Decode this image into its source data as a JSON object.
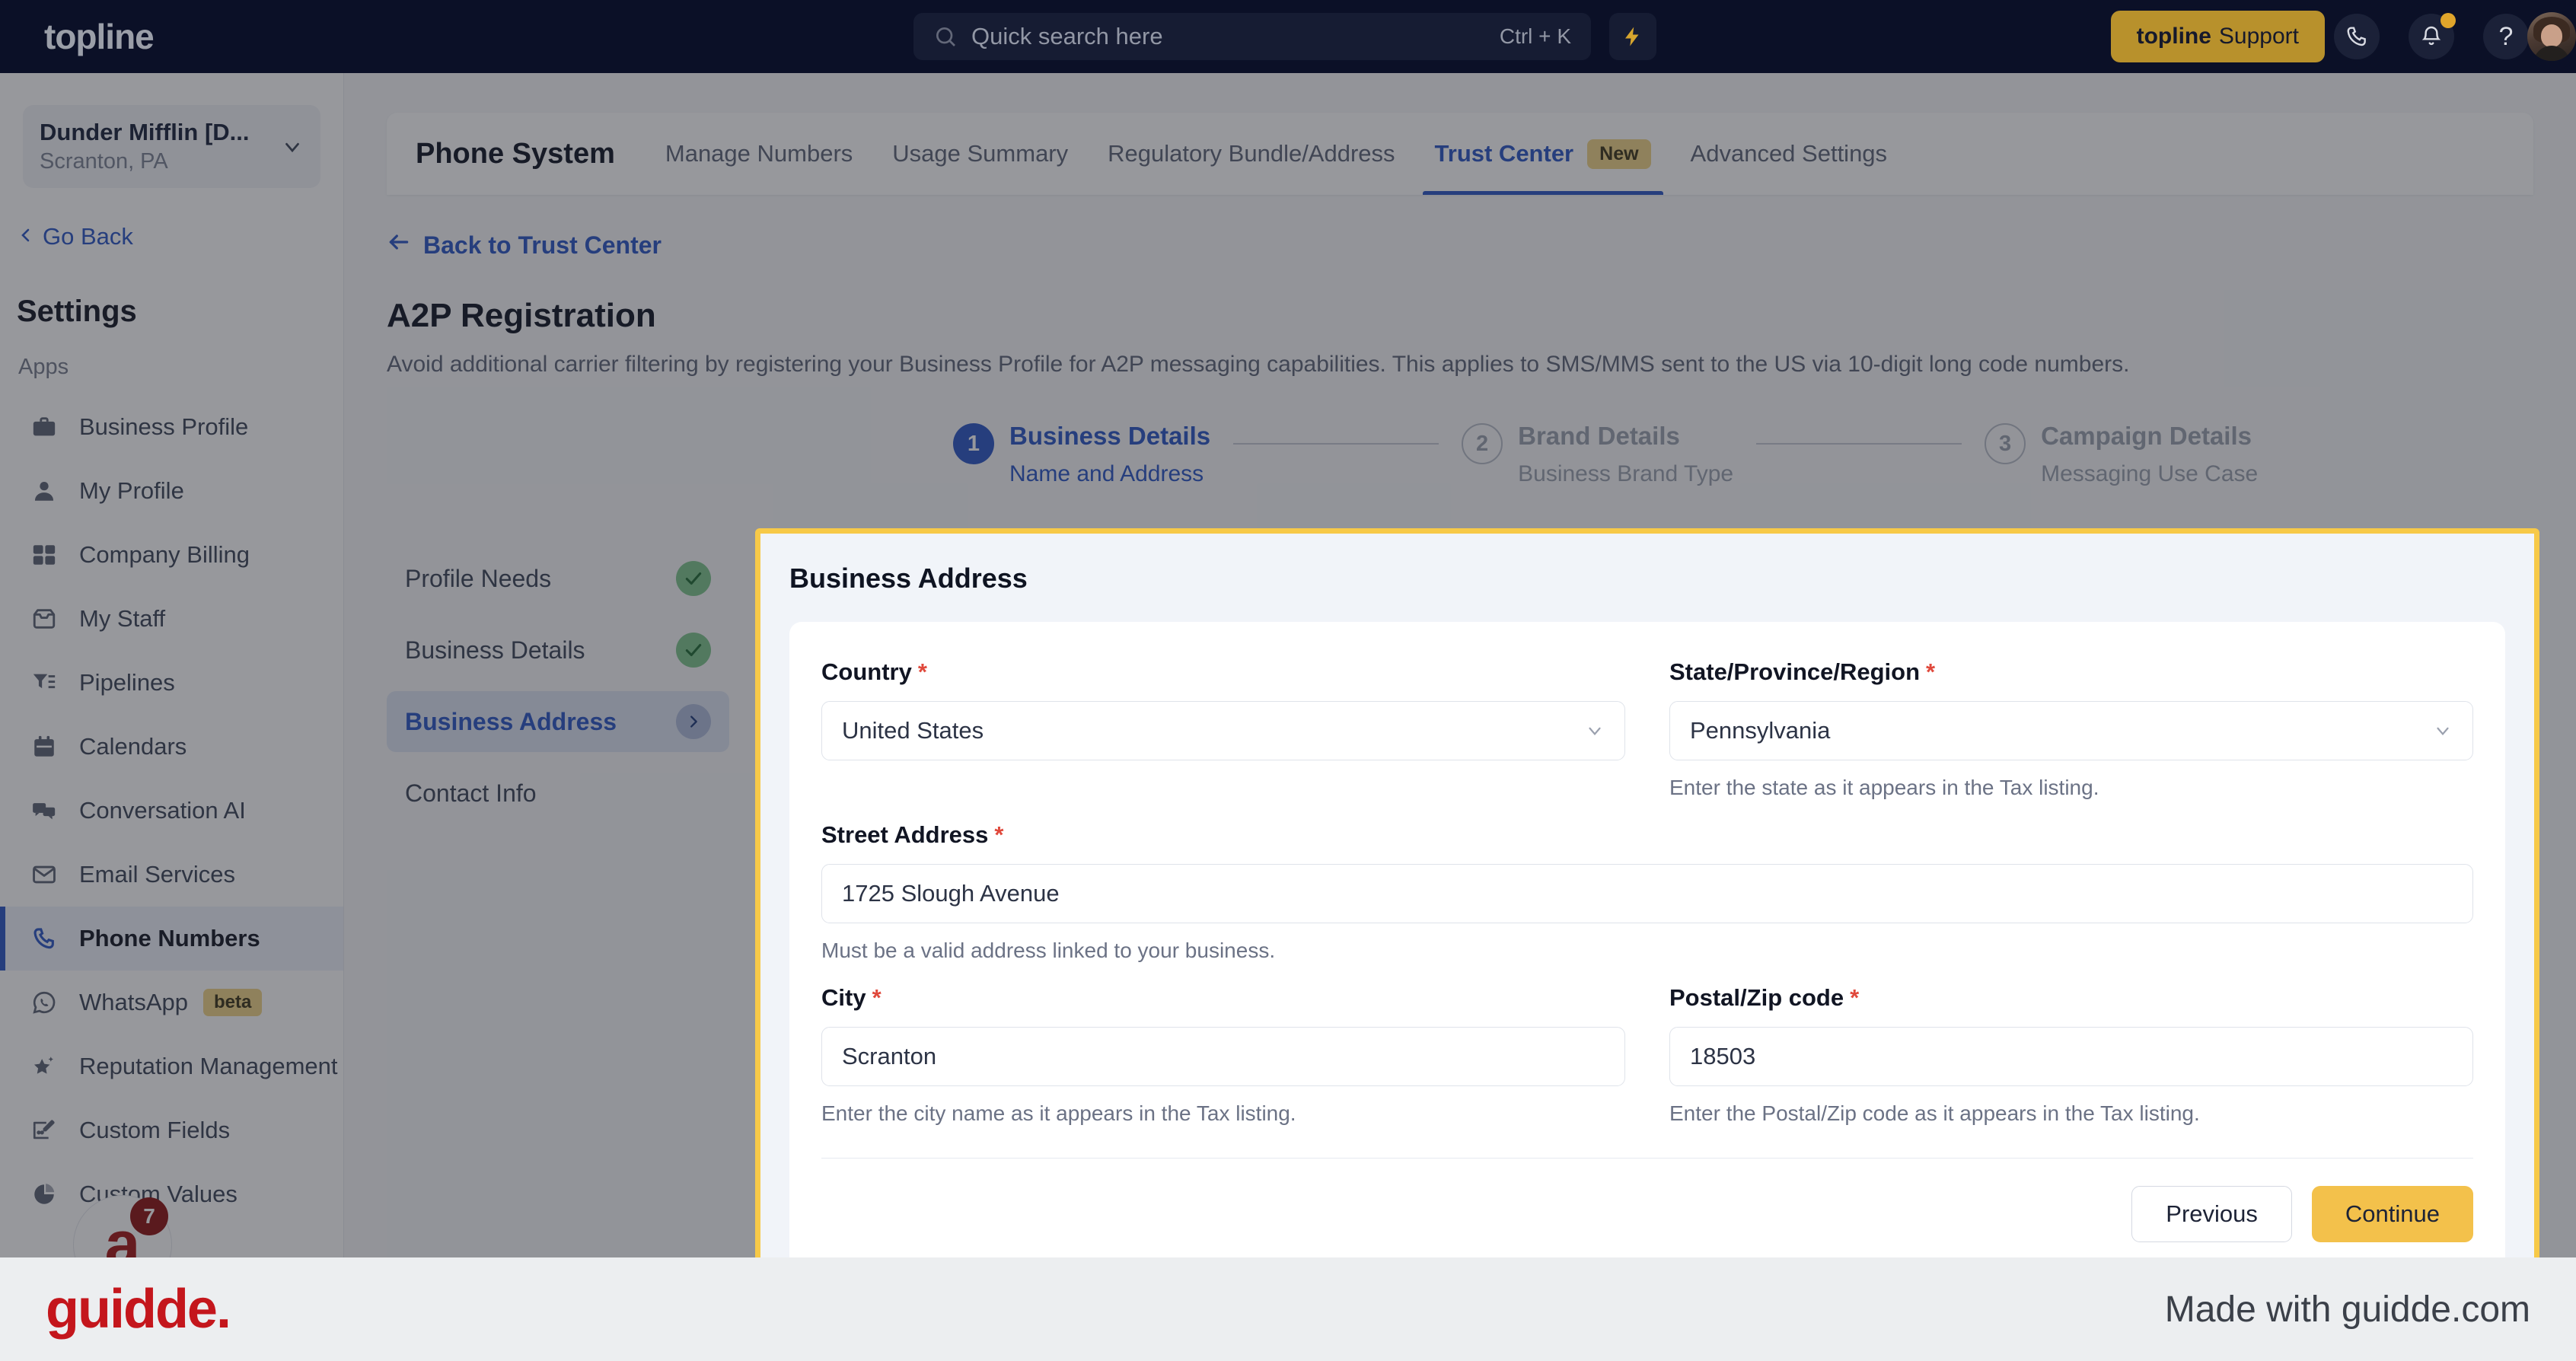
{
  "topbar": {
    "logo": "topline",
    "search": {
      "placeholder": "Quick search here",
      "shortcut": "Ctrl + K"
    },
    "bolt_icon": "lightning-bolt-icon",
    "support_button": {
      "brand": "topline",
      "label": "Support"
    },
    "phone_icon": "phone-icon",
    "bell_icon": "bell-icon",
    "help_icon": "?",
    "avatar": "user-avatar"
  },
  "sidebar": {
    "org": {
      "name": "Dunder Mifflin [D...",
      "location": "Scranton, PA",
      "chevron": "chevron-down-icon"
    },
    "go_back": "Go Back",
    "title": "Settings",
    "group_label": "Apps",
    "items": [
      {
        "label": "Business Profile",
        "icon": "briefcase-icon",
        "active": false
      },
      {
        "label": "My Profile",
        "icon": "person-icon",
        "active": false
      },
      {
        "label": "Company Billing",
        "icon": "calculator-icon",
        "active": false
      },
      {
        "label": "My Staff",
        "icon": "inbox-icon",
        "active": false
      },
      {
        "label": "Pipelines",
        "icon": "filter-icon",
        "active": false
      },
      {
        "label": "Calendars",
        "icon": "calendar-icon",
        "active": false
      },
      {
        "label": "Conversation AI",
        "icon": "chat-bubbles-icon",
        "active": false
      },
      {
        "label": "Email Services",
        "icon": "envelope-icon",
        "active": false
      },
      {
        "label": "Phone Numbers",
        "icon": "phone-icon",
        "active": true
      },
      {
        "label": "WhatsApp",
        "icon": "whatsapp-icon",
        "badge": "beta",
        "active": false
      },
      {
        "label": "Reputation Management",
        "icon": "star-sparkle-icon",
        "active": false
      },
      {
        "label": "Custom Fields",
        "icon": "pencil-box-icon",
        "active": false
      },
      {
        "label": "Custom Values",
        "icon": "pie-chart-icon",
        "active": false
      }
    ],
    "fab": {
      "glyph": "a",
      "badge": "7"
    }
  },
  "main": {
    "section_title": "Phone System",
    "tabs": [
      {
        "label": "Manage Numbers",
        "active": false
      },
      {
        "label": "Usage Summary",
        "active": false
      },
      {
        "label": "Regulatory Bundle/Address",
        "active": false
      },
      {
        "label": "Trust Center",
        "active": true,
        "badge": "New"
      },
      {
        "label": "Advanced Settings",
        "active": false
      }
    ],
    "back_link": "Back to Trust Center",
    "page_title": "A2P Registration",
    "page_desc": "Avoid additional carrier filtering by registering your Business Profile for A2P messaging capabilities. This applies to SMS/MMS sent to the US via 10-digit long code numbers.",
    "stepper": [
      {
        "num": "1",
        "title": "Business Details",
        "sub": "Name and Address",
        "state": "done"
      },
      {
        "num": "2",
        "title": "Brand Details",
        "sub": "Business Brand Type",
        "state": "todo"
      },
      {
        "num": "3",
        "title": "Campaign Details",
        "sub": "Messaging Use Case",
        "state": "todo"
      }
    ],
    "subnav": [
      {
        "label": "Profile Needs",
        "status": "check",
        "active": false
      },
      {
        "label": "Business Details",
        "status": "check",
        "active": false
      },
      {
        "label": "Business Address",
        "status": "arrow",
        "active": true
      },
      {
        "label": "Contact Info",
        "status": "none",
        "active": false
      }
    ],
    "form": {
      "card_title": "Business Address",
      "country": {
        "label": "Country",
        "value": "United States",
        "required": "*"
      },
      "state": {
        "label": "State/Province/Region",
        "value": "Pennsylvania",
        "required": "*",
        "help": "Enter the state as it appears in the Tax listing."
      },
      "street": {
        "label": "Street Address",
        "value": "1725 Slough Avenue",
        "required": "*",
        "help": "Must be a valid address linked to your business."
      },
      "city": {
        "label": "City",
        "value": "Scranton",
        "required": "*",
        "help": "Enter the city name as it appears in the Tax listing."
      },
      "postal": {
        "label": "Postal/Zip code",
        "value": "18503",
        "required": "*",
        "help": "Enter the Postal/Zip code as it appears in the Tax listing."
      },
      "previous_label": "Previous",
      "continue_label": "Continue"
    }
  },
  "footer": {
    "logo": "guidde.",
    "made_with": "Made with guidde.com"
  },
  "colors": {
    "topbar_bg": "#0b1027",
    "accent_blue": "#2b56c4",
    "accent_gold": "#f3c14b",
    "highlight_border": "#f7c948",
    "check_green": "#7ec48d",
    "required_red": "#e0493c",
    "guidde_red": "#c4161c"
  }
}
